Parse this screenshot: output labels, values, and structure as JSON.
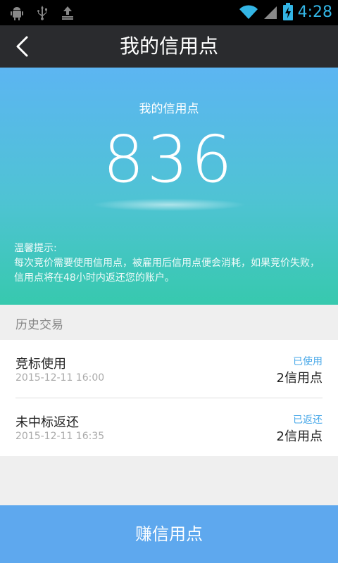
{
  "status_bar": {
    "time": "4:28",
    "icons": [
      "android-debug-icon",
      "usb-icon",
      "upload-icon",
      "wifi-icon",
      "signal-icon",
      "battery-charging-icon"
    ]
  },
  "app_bar": {
    "title": "我的信用点",
    "back_icon": "chevron-left-icon"
  },
  "hero": {
    "label": "我的信用点",
    "credit_points": "836",
    "tip_title": "温馨提示:",
    "tip_text": "每次竞价需要使用信用点，被雇用后信用点便会消耗，如果竞价失败，信用点将在48小时内返还您的账户。"
  },
  "history": {
    "header": "历史交易",
    "items": [
      {
        "title": "竞标使用",
        "time": "2015-12-11 16:00",
        "status": "已使用",
        "amount": "2信用点"
      },
      {
        "title": "未中标返还",
        "time": "2015-12-11 16:35",
        "status": "已返还",
        "amount": "2信用点"
      }
    ]
  },
  "earn_button": {
    "label": "赚信用点"
  },
  "colors": {
    "status_accent": "#33b5e5",
    "appbar_bg": "#2a2b2e",
    "hero_top": "#5cb5f2",
    "hero_bottom": "#37c9ae",
    "status_link": "#4aa9e9",
    "button_bg": "#5ea8ee"
  }
}
